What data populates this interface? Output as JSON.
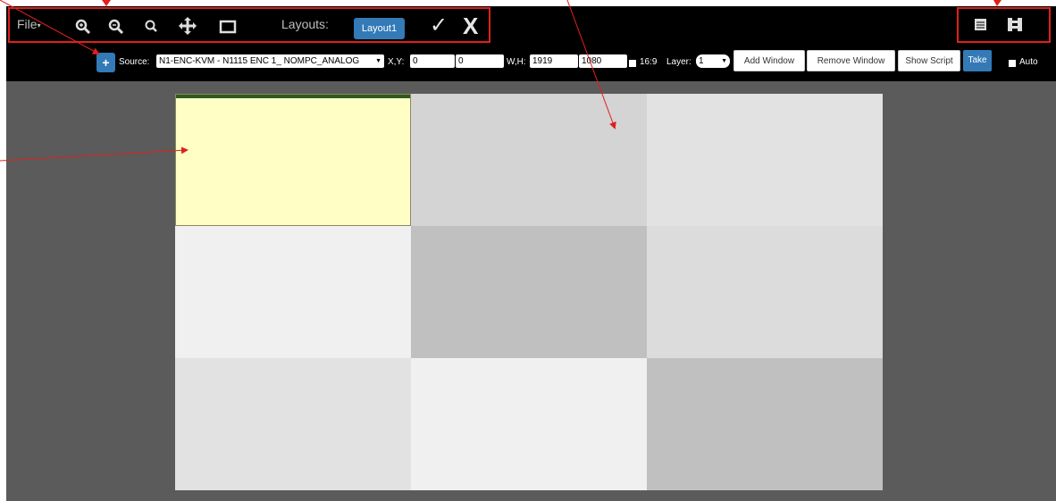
{
  "menu": {
    "file_label": "File"
  },
  "toolbar": {
    "layouts_label": "Layouts:",
    "layout_button": "Layout1",
    "confirm_icon": "check-icon",
    "cancel_icon": "close-icon",
    "tool_icons": [
      "zoom-in-icon",
      "zoom-out-icon",
      "zoom-reset-icon",
      "move-icon",
      "fullscreen-icon"
    ],
    "right_icons": [
      "list-icon",
      "grid-icon"
    ]
  },
  "controls": {
    "source_label": "Source:",
    "source_value": "N1-ENC-KVM - N1115 ENC 1_ NOMPC_ANALOG",
    "xy_label": "X,Y:",
    "x_value": "0",
    "y_value": "0",
    "wh_label": "W,H:",
    "w_value": "1919",
    "h_value": "1080",
    "ratio_label": "16:9",
    "layer_label": "Layer:",
    "layer_value": "1",
    "add_window": "Add Window",
    "remove_window": "Remove Window",
    "show_script": "Show Script",
    "take": "Take",
    "auto_label": "Auto"
  },
  "colors": {
    "accent": "#337ab7",
    "annotation": "#e0201b",
    "window_fill": "#ffffc5"
  },
  "grid": {
    "rows": 3,
    "cols": 3,
    "cell_colors": [
      "#ffffc5",
      "#d4d4d4",
      "#e2e2e2",
      "#f0f0f0",
      "#c0c0c0",
      "#dcdcdc",
      "#e2e2e2",
      "#f0f0f0",
      "#c0c0c0"
    ]
  }
}
